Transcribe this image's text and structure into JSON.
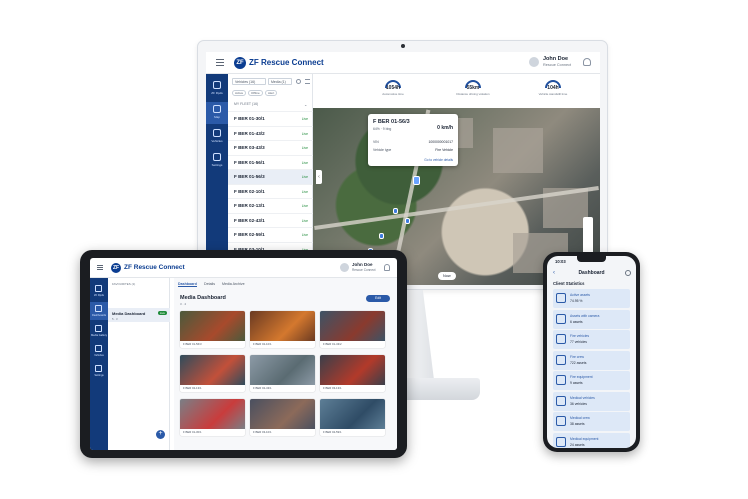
{
  "monitor": {
    "logo_badge": "ZF",
    "app_title": "ZF Rescue Connect",
    "user": {
      "name": "John Doe",
      "org": "Rescue Connect"
    },
    "nav": [
      {
        "label": "ZF Rpds"
      },
      {
        "label": "Map"
      },
      {
        "label": "Vehicles"
      },
      {
        "label": "Settings"
      }
    ],
    "filters": {
      "vehicle_filter": "Vehicles (16)",
      "media_filter": "Media (1)"
    },
    "chips": [
      "Active",
      "Offline",
      "Alert"
    ],
    "fleet_label": "MY FLEET (16)",
    "vehicles": [
      {
        "name": "F BER 01-30/1",
        "status": "Live"
      },
      {
        "name": "F BER 01-43/2",
        "status": "Live"
      },
      {
        "name": "F BER 03-43/3",
        "status": "Live"
      },
      {
        "name": "F BER 01-56/1",
        "status": "Live"
      },
      {
        "name": "F BER 01-56/3",
        "status": "Live"
      },
      {
        "name": "F BER 02-10/1",
        "status": "Live"
      },
      {
        "name": "F BER 02-13/1",
        "status": "Live"
      },
      {
        "name": "F BER 02-43/1",
        "status": "Live"
      },
      {
        "name": "F BER 02-59/1",
        "status": "Live"
      },
      {
        "name": "F BER 03-10/1",
        "status": "Live"
      },
      {
        "name": "F BER 03-13/1",
        "status": "Live"
      }
    ],
    "stats": [
      {
        "value": "1054h",
        "label": "Automotive time"
      },
      {
        "value": "55km",
        "label": "Distance driving violation"
      },
      {
        "value": "104h",
        "label": "Vehicle standstill time"
      }
    ],
    "popup": {
      "title": "F BER 01-56/3",
      "sub": "64% · 9 bbg",
      "speed": "0 km/h",
      "rows": [
        {
          "key": "VIN",
          "value": "1000000001017"
        },
        {
          "key": "Vehicle type",
          "value": "Fire Vehicle"
        }
      ],
      "link": "Go to vehicle details"
    },
    "now_label": "Now"
  },
  "tablet": {
    "logo_badge": "ZF",
    "app_title": "ZF Rescue Connect",
    "user": {
      "name": "John Doe",
      "org": "Rescue Connect"
    },
    "nav": [
      {
        "label": "ZF Rpds"
      },
      {
        "label": "Dashboards"
      },
      {
        "label": "Media Gallery"
      },
      {
        "label": "Vehicles"
      },
      {
        "label": "Settings"
      }
    ],
    "list_header": "FAVOURITES (1)",
    "dashboard_item": {
      "name": "Media Dashboard",
      "badge": "Live",
      "sub": "5 · 3"
    },
    "fab": "+",
    "tabs": [
      "Dashboard",
      "Details",
      "Media Archive"
    ],
    "title": "Media Dashboard",
    "title_sub": "3 · 4",
    "edit_label": "Edit",
    "tiles": [
      {
        "caption": "F BER 01-56/3",
        "color_a": "#4b5a3c",
        "color_b": "#a84a2c"
      },
      {
        "caption": "F BER 02-10/1",
        "color_a": "#6a3a22",
        "color_b": "#d4782e"
      },
      {
        "caption": "F BER 01-43/2",
        "color_a": "#3d5366",
        "color_b": "#8a3a2e"
      },
      {
        "caption": "F BER 02-13/1",
        "color_a": "#2f4c5c",
        "color_b": "#c2503a"
      },
      {
        "caption": "F BER 02-43/1",
        "color_a": "#8c9aa6",
        "color_b": "#5a6b72"
      },
      {
        "caption": "F BER 03-13/1",
        "color_a": "#3a3f4a",
        "color_b": "#b23a2a"
      },
      {
        "caption": "F BER 01-30/1",
        "color_a": "#7a7f86",
        "color_b": "#c93c3c"
      },
      {
        "caption": "F BER 03-10/1",
        "color_a": "#4a5060",
        "color_b": "#8c6a5a"
      },
      {
        "caption": "F BER 02-59/1",
        "color_a": "#5d7e96",
        "color_b": "#2f4c66"
      }
    ]
  },
  "phone": {
    "time": "10:03",
    "title": "Dashboard",
    "section": "Client Statistics",
    "cards": [
      {
        "title": "Active assets",
        "value": "74.95 %"
      },
      {
        "title": "Assets with camera",
        "value": "6 assets"
      },
      {
        "title": "Fire vehicles",
        "value": "77 vehicles"
      },
      {
        "title": "Fire crew",
        "value": "722 assets"
      },
      {
        "title": "Fire equipment",
        "value": "9 assets"
      },
      {
        "title": "Medical vehicles",
        "value": "36 vehicles"
      },
      {
        "title": "Medical crew",
        "value": "38 assets"
      },
      {
        "title": "Medical equipment",
        "value": "24 assets"
      }
    ]
  }
}
